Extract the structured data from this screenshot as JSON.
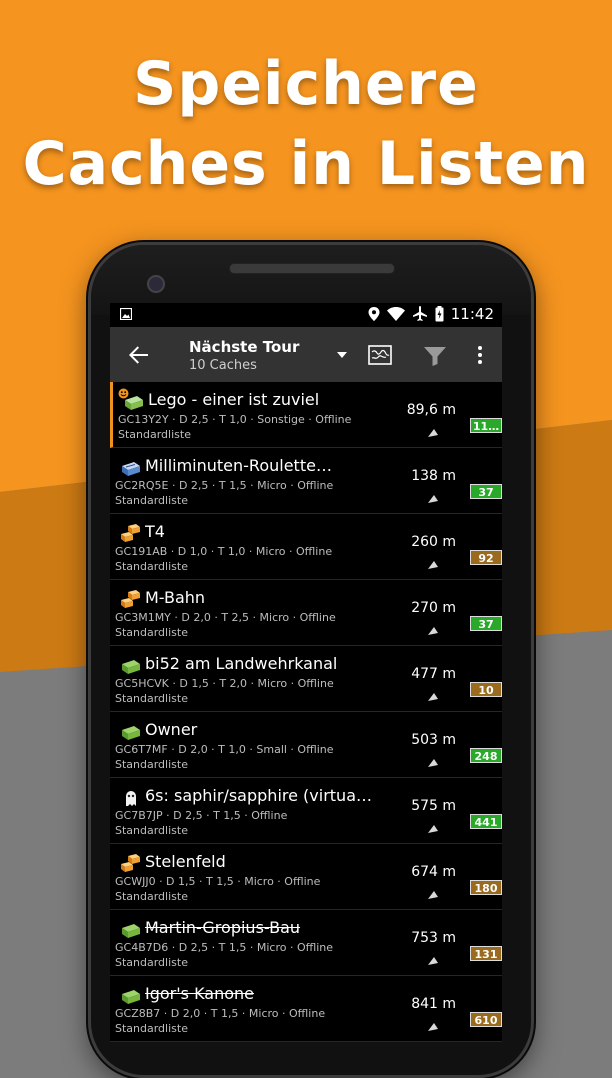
{
  "promo": {
    "line1": "Speichere",
    "line2": "Caches in Listen"
  },
  "colors": {
    "orange": "#f5941f",
    "dark_orange": "#cc7a14",
    "gray": "#7c7c7c",
    "accent": "#f0921e"
  },
  "statusbar": {
    "time": "11:42",
    "icons": [
      "image-icon",
      "location-icon",
      "wifi-icon",
      "airplane-icon",
      "battery-icon"
    ]
  },
  "toolbar": {
    "title": "Nächste Tour",
    "subtitle": "10 Caches",
    "actions": [
      "back-icon",
      "dropdown-icon",
      "map-icon",
      "filter-icon",
      "overflow-icon"
    ]
  },
  "caches": [
    {
      "name": "Lego - einer ist zuviel",
      "meta": "GC13Y2Y · D 2,5 · T 1,0 · Sonstige · Offline",
      "list": "Standardliste",
      "distance": "89,6 m",
      "badge": "11…",
      "badge_color": "green",
      "icon": "other-cache-icon",
      "strike": false,
      "selected": true
    },
    {
      "name": "Milliminuten-Roulette…",
      "meta": "GC2RQ5E · D 2,5 · T 1,5 · Micro · Offline",
      "list": "Standardliste",
      "distance": "138 m",
      "badge": "37",
      "badge_color": "green",
      "icon": "mystery-cache-icon",
      "strike": false,
      "selected": false
    },
    {
      "name": "T4",
      "meta": "GC191AB · D 1,0 · T 1,0 · Micro · Offline",
      "list": "Standardliste",
      "distance": "260 m",
      "badge": "92",
      "badge_color": "brown",
      "icon": "multi-cache-icon",
      "strike": false,
      "selected": false
    },
    {
      "name": "M-Bahn",
      "meta": "GC3M1MY · D 2,0 · T 2,5 · Micro · Offline",
      "list": "Standardliste",
      "distance": "270 m",
      "badge": "37",
      "badge_color": "green",
      "icon": "multi-cache-icon",
      "strike": false,
      "selected": false
    },
    {
      "name": "bi52 am Landwehrkanal",
      "meta": "GC5HCVK · D 1,5 · T 2,0 · Micro · Offline",
      "list": "Standardliste",
      "distance": "477 m",
      "badge": "10",
      "badge_color": "brown",
      "icon": "traditional-cache-icon",
      "strike": false,
      "selected": false
    },
    {
      "name": "Owner",
      "meta": "GC6T7MF · D 2,0 · T 1,0 · Small · Offline",
      "list": "Standardliste",
      "distance": "503 m",
      "badge": "248",
      "badge_color": "green",
      "icon": "traditional-cache-icon",
      "strike": false,
      "selected": false
    },
    {
      "name": "6s: saphir/sapphire (virtual…",
      "meta": "GC7B7JP · D 2,5 · T 1,5 · Offline",
      "list": "Standardliste",
      "distance": "575 m",
      "badge": "441",
      "badge_color": "green",
      "icon": "virtual-cache-icon",
      "strike": false,
      "selected": false
    },
    {
      "name": "Stelenfeld",
      "meta": "GCWJJ0 · D 1,5 · T 1,5 · Micro · Offline",
      "list": "Standardliste",
      "distance": "674 m",
      "badge": "180",
      "badge_color": "brown",
      "icon": "multi-cache-icon",
      "strike": false,
      "selected": false
    },
    {
      "name": "Martin-Gropius-Bau",
      "meta": "GC4B7D6 · D 2,5 · T 1,5 · Micro · Offline",
      "list": "Standardliste",
      "distance": "753 m",
      "badge": "131",
      "badge_color": "brown",
      "icon": "traditional-cache-icon",
      "strike": true,
      "selected": false
    },
    {
      "name": "Igor's Kanone",
      "meta": "GCZ8B7 · D 2,0 · T 1,5 · Micro · Offline",
      "list": "Standardliste",
      "distance": "841 m",
      "badge": "610",
      "badge_color": "brown",
      "icon": "traditional-cache-icon",
      "strike": true,
      "selected": false
    }
  ]
}
